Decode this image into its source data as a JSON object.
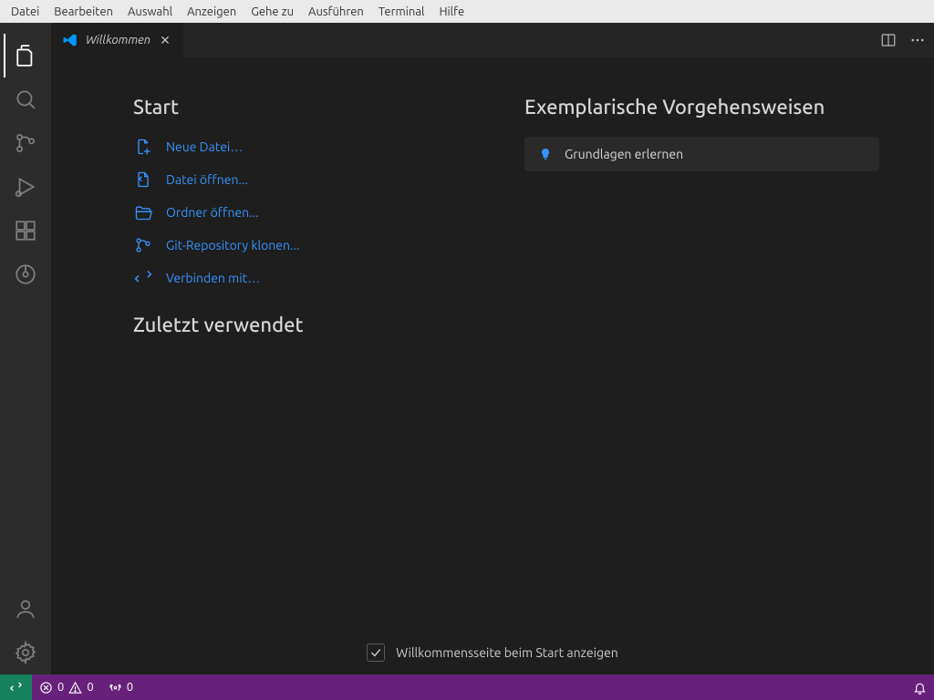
{
  "menubar": {
    "items": [
      "Datei",
      "Bearbeiten",
      "Auswahl",
      "Anzeigen",
      "Gehe zu",
      "Ausführen",
      "Terminal",
      "Hilfe"
    ]
  },
  "tab": {
    "title": "Willkommen"
  },
  "welcome": {
    "start_heading": "Start",
    "recent_heading": "Zuletzt verwendet",
    "walkthroughs_heading": "Exemplarische Vorgehensweisen",
    "start_items": [
      {
        "label": "Neue Datei…"
      },
      {
        "label": "Datei öffnen..."
      },
      {
        "label": "Ordner öffnen..."
      },
      {
        "label": "Git-Repository klonen..."
      },
      {
        "label": "Verbinden mit…"
      }
    ],
    "walkthrough": {
      "label": "Grundlagen erlernen"
    },
    "show_on_startup": "Willkommensseite beim Start anzeigen"
  },
  "statusbar": {
    "errors": "0",
    "warnings": "0",
    "ports": "0"
  }
}
